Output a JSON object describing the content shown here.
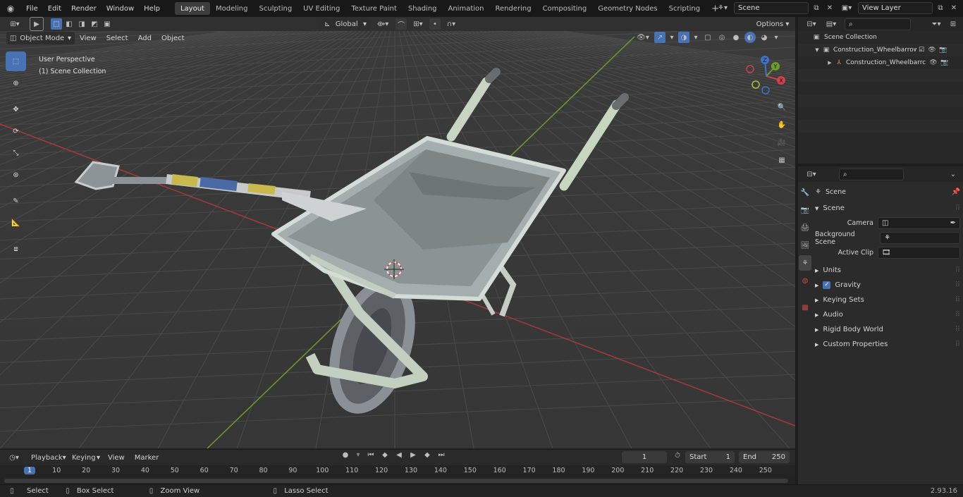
{
  "menus": [
    "File",
    "Edit",
    "Render",
    "Window",
    "Help"
  ],
  "workspaces": [
    "Layout",
    "Modeling",
    "Sculpting",
    "UV Editing",
    "Texture Paint",
    "Shading",
    "Animation",
    "Rendering",
    "Compositing",
    "Geometry Nodes",
    "Scripting"
  ],
  "active_workspace": "Layout",
  "scene_field": "Scene",
  "view_layer_field": "View Layer",
  "header": {
    "mode": "Object Mode",
    "menus": [
      "View",
      "Select",
      "Add",
      "Object"
    ],
    "orientation": "Global",
    "options": "Options"
  },
  "viewport": {
    "perspective_label": "User Perspective",
    "collection_label": "(1) Scene Collection",
    "gizmo": {
      "x": "X",
      "y": "Y",
      "z": "Z"
    }
  },
  "outliner": {
    "root": "Scene Collection",
    "items": [
      {
        "label": "Construction_Wheelbarrow_F"
      },
      {
        "label": "Construction_Wheelbarrc"
      }
    ]
  },
  "properties": {
    "breadcrumb": "Scene",
    "section": "Scene",
    "fields": [
      {
        "label": "Camera"
      },
      {
        "label": "Background Scene"
      },
      {
        "label": "Active Clip"
      }
    ],
    "panels": [
      "Units",
      "Gravity",
      "Keying Sets",
      "Audio",
      "Rigid Body World",
      "Custom Properties"
    ]
  },
  "timeline": {
    "menus": [
      "Playback",
      "Keying",
      "View",
      "Marker"
    ],
    "current_frame": "1",
    "start_label": "Start",
    "start": "1",
    "end_label": "End",
    "end": "250",
    "ruler": [
      "1",
      "10",
      "20",
      "30",
      "40",
      "50",
      "60",
      "70",
      "80",
      "90",
      "100",
      "110",
      "120",
      "130",
      "140",
      "150",
      "160",
      "170",
      "180",
      "190",
      "200",
      "210",
      "220",
      "230",
      "240",
      "250"
    ]
  },
  "statusbar": {
    "items": [
      "Select",
      "Box Select",
      "Zoom View",
      "Lasso Select"
    ],
    "version": "2.93.16"
  },
  "colors": {
    "accent": "#4772b3",
    "axis_x": "#a83a3a",
    "axis_y": "#6f9a2a",
    "workspace_active": "#3d3d3d"
  }
}
